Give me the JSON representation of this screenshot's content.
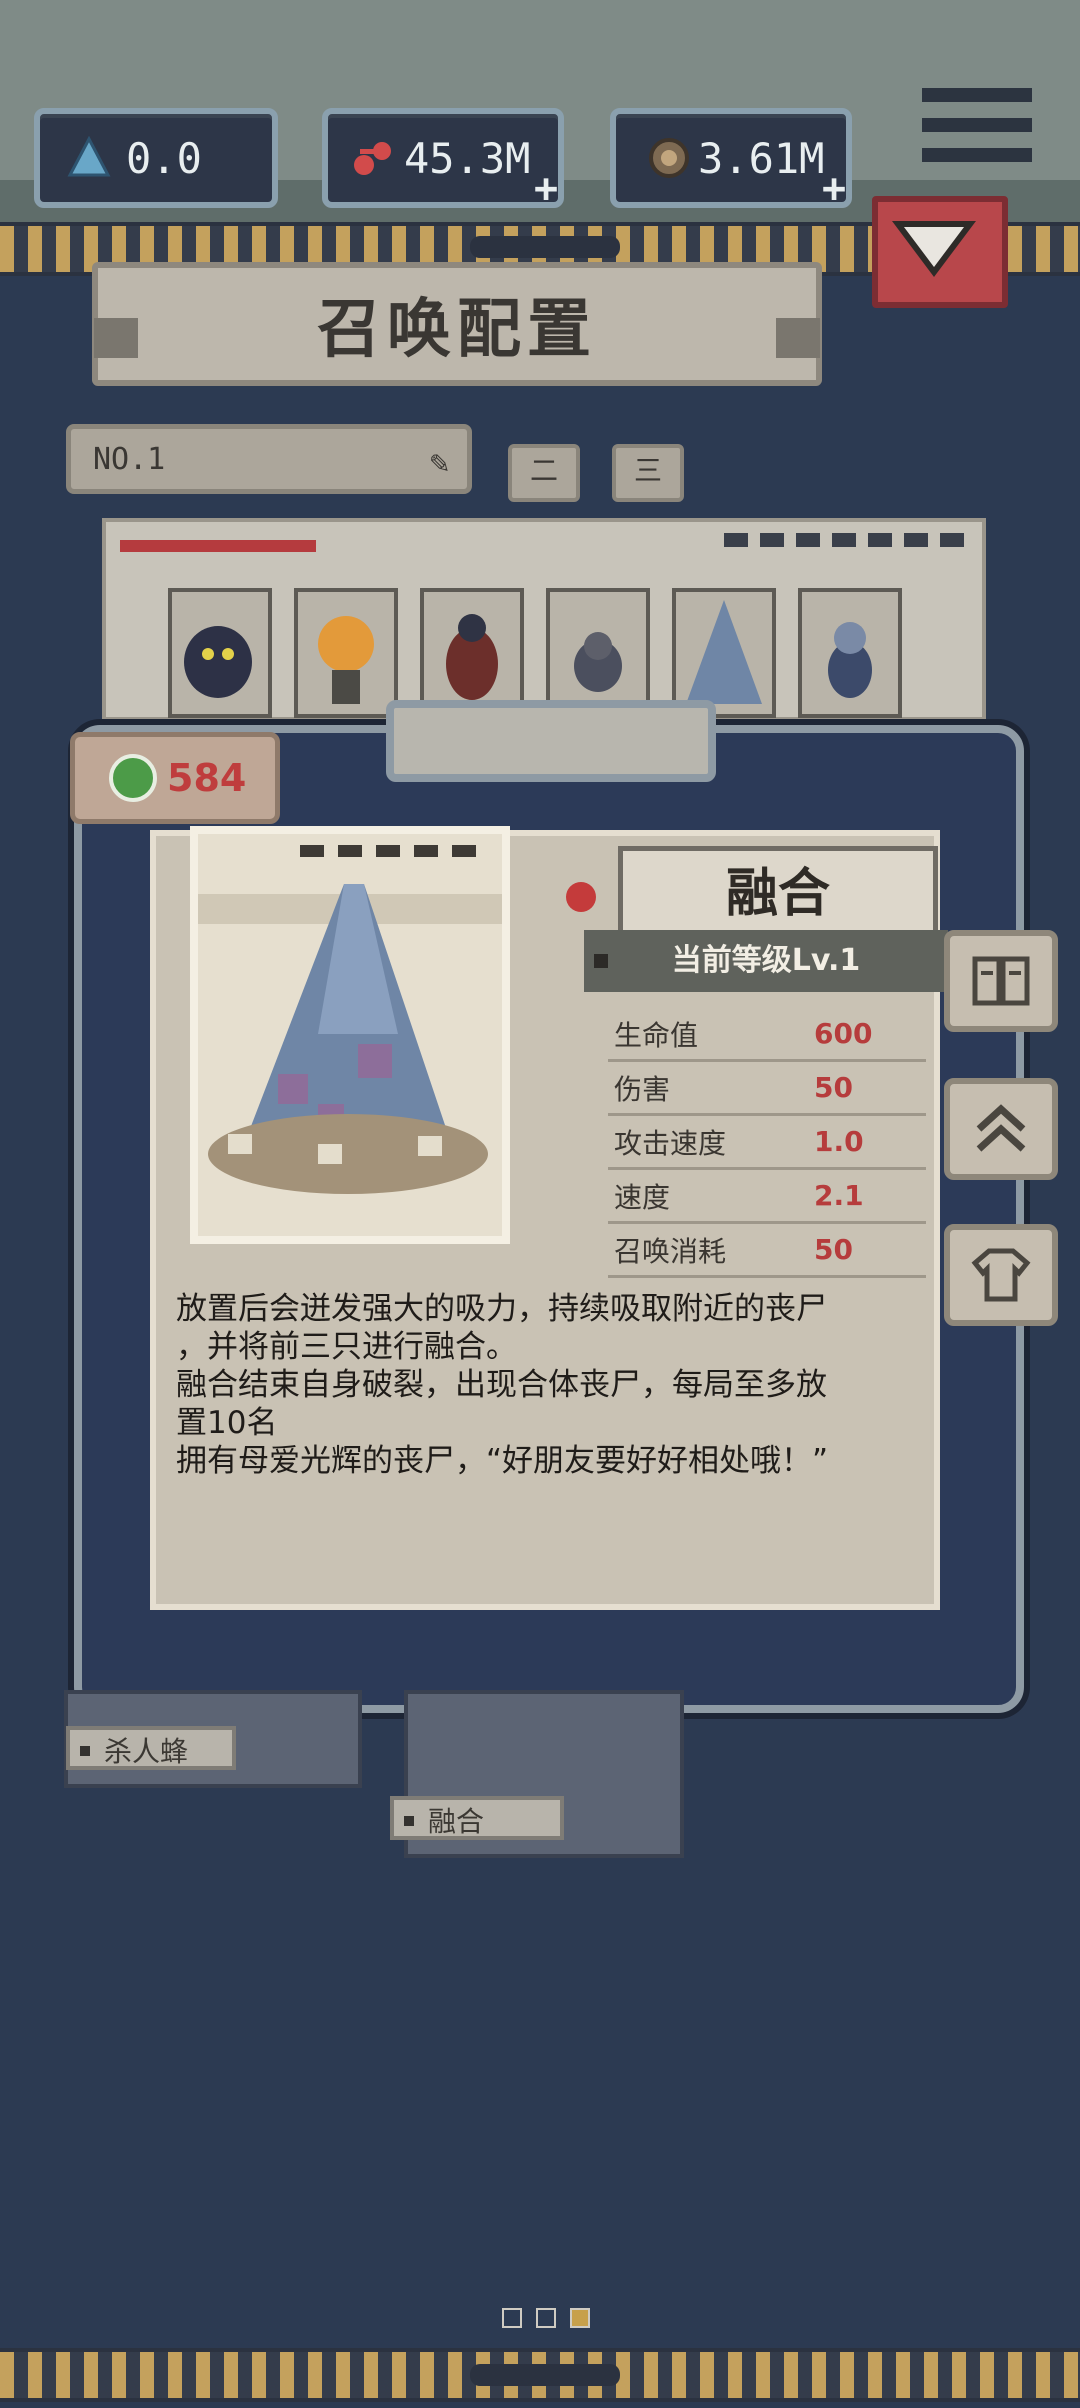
{
  "resources": {
    "gems": "0.0",
    "blood": "45.3M",
    "coins": "3.61M"
  },
  "summon_config": {
    "title": "召唤配置",
    "preset_name": "NO.1",
    "preset_buttons": [
      "二",
      "三"
    ]
  },
  "currency_counter": "584",
  "unit": {
    "name": "融合",
    "level": "当前等级Lv.1",
    "stats": [
      {
        "label": "生命值",
        "value": "600"
      },
      {
        "label": "伤害",
        "value": "50"
      },
      {
        "label": "攻击速度",
        "value": "1.0"
      },
      {
        "label": "速度",
        "value": "2.1"
      },
      {
        "label": "召唤消耗",
        "value": "50"
      }
    ],
    "description": [
      "放置后会迸发强大的吸力，持续吸取附近的丧尸",
      "，并将前三只进行融合。",
      "融合结束自身破裂，出现合体丧尸，每局至多放",
      "置10名",
      "拥有母爱光辉的丧尸，“好朋友要好好相处哦！”"
    ]
  },
  "side_buttons": [
    "book-icon",
    "upgrade-icon",
    "skin-icon"
  ],
  "bottom_cards": [
    {
      "name": "杀人蜂"
    },
    {
      "name": "融合"
    }
  ],
  "pager": {
    "current": 3,
    "total": 3
  },
  "colors": {
    "accent_red": "#b63c3c",
    "panel_bg": "#2c3a58",
    "paper": "#c9c2b4"
  }
}
